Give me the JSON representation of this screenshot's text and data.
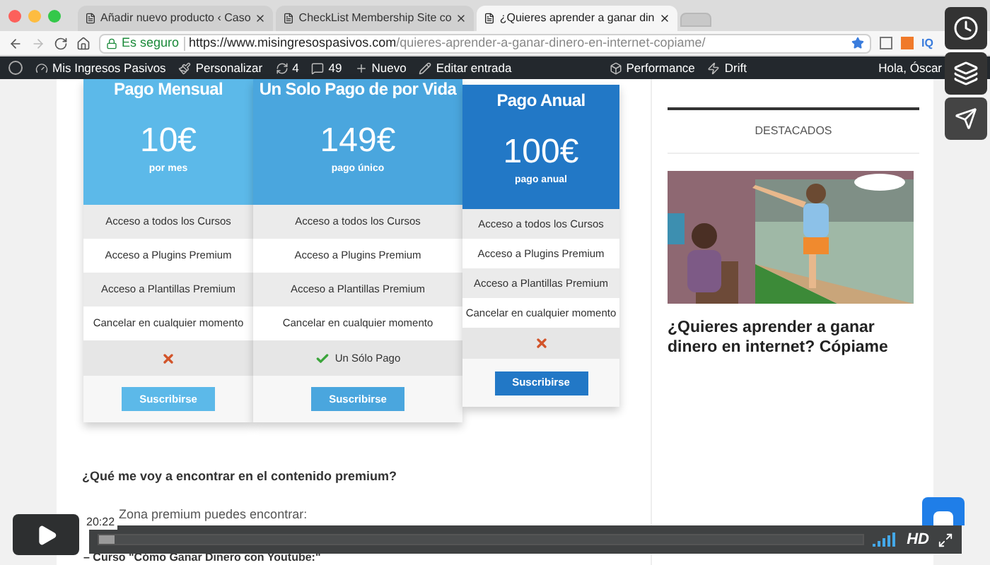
{
  "browser": {
    "tabs": [
      {
        "title": "Añadir nuevo producto ‹ Caso",
        "selected": false
      },
      {
        "title": "CheckList Membership Site co",
        "selected": false
      },
      {
        "title": "¿Quieres aprender a ganar din",
        "selected": true
      }
    ],
    "address": {
      "secure_label": "Es seguro",
      "host": "https://www.misingresospasivos.com",
      "path": "/quieres-aprender-a-ganar-dinero-en-internet-copiame/",
      "extension_label": "IQ"
    }
  },
  "admin_bar": {
    "items": [
      {
        "label": "Mis Ingresos Pasivos"
      },
      {
        "label": "Personalizar"
      },
      {
        "label": "4"
      },
      {
        "label": "49"
      },
      {
        "label": "Nuevo"
      },
      {
        "label": "Editar entrada"
      },
      {
        "label": "Performance"
      },
      {
        "label": "Drift"
      }
    ],
    "greeting": "Hola, Óscar"
  },
  "plans": [
    {
      "name": "Pago Mensual",
      "price": "10€",
      "period": "por mes",
      "color": "#5cb9e9",
      "features": [
        "Acceso a todos los Cursos",
        "Acceso a Plugins Premium",
        "Acceso a Plantillas Premium",
        "Cancelar en cualquier momento"
      ],
      "extra": {
        "kind": "cross"
      },
      "button": "Suscribirse"
    },
    {
      "name": "Un Solo Pago de por Vida",
      "price": "149€",
      "period": "pago único",
      "color": "#4aa6de",
      "features": [
        "Acceso a todos los Cursos",
        "Acceso a Plugins Premium",
        "Acceso a Plantillas Premium",
        "Cancelar en cualquier momento"
      ],
      "extra": {
        "kind": "check",
        "label": "Un Sólo Pago"
      },
      "button": "Suscribirse"
    },
    {
      "name": "Pago Anual",
      "price": "100€",
      "period": "pago anual",
      "color": "#2278c6",
      "features": [
        "Acceso a todos los Cursos",
        "Acceso a Plugins Premium",
        "Acceso a Plantillas Premium",
        "Cancelar en cualquier momento"
      ],
      "extra": {
        "kind": "cross"
      },
      "button": "Suscribirse"
    }
  ],
  "article": {
    "heading": "¿Qué me voy a encontrar en el contenido premium?",
    "paragraph": "Zona premium puedes encontrar:",
    "list_item": "– Curso \"Cómo Ganar Dinero con Youtube:\""
  },
  "sidebar": {
    "heading": "DESTACADOS",
    "post": {
      "kind": "picture",
      "title": "¿Quieres aprender a ganar dinero en internet? Cópiame"
    }
  },
  "video": {
    "time": "20:22",
    "quality": "HD",
    "level": 0.02
  }
}
